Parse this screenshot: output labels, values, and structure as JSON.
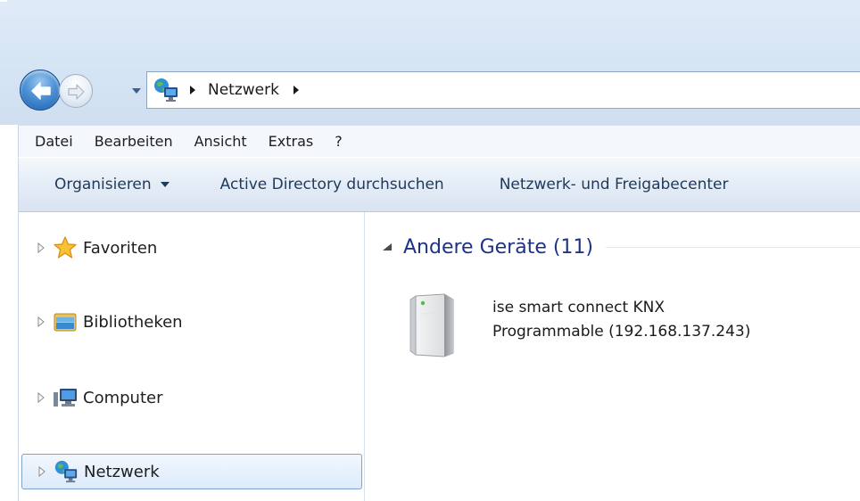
{
  "address": {
    "location": "Netzwerk",
    "location_icon": "network-icon"
  },
  "navigation": {
    "back_icon": "back-arrow-icon",
    "forward_icon": "forward-arrow-icon",
    "history_icon": "chevron-down-icon"
  },
  "menubar": {
    "items": [
      "Datei",
      "Bearbeiten",
      "Ansicht",
      "Extras",
      "?"
    ]
  },
  "commandbar": {
    "organize": "Organisieren",
    "active_directory": "Active Directory durchsuchen",
    "network_center": "Netzwerk- und Freigabecenter"
  },
  "navpane": {
    "items": [
      {
        "label": "Favoriten",
        "icon": "star-icon"
      },
      {
        "label": "Bibliotheken",
        "icon": "library-icon"
      },
      {
        "label": "Computer",
        "icon": "computer-icon"
      },
      {
        "label": "Netzwerk",
        "icon": "network-icon",
        "selected": true
      }
    ]
  },
  "content": {
    "group_title": "Andere Geräte (11)",
    "devices": [
      {
        "name_line1": "ise smart connect KNX",
        "name_line2": "Programmable (192.168.137.243)",
        "icon": "device-icon"
      }
    ]
  },
  "colors": {
    "chrome_background": "#d7e6f5",
    "group_title": "#1e3287",
    "command_text": "#1e395b",
    "selection_border": "#7da2ce"
  }
}
